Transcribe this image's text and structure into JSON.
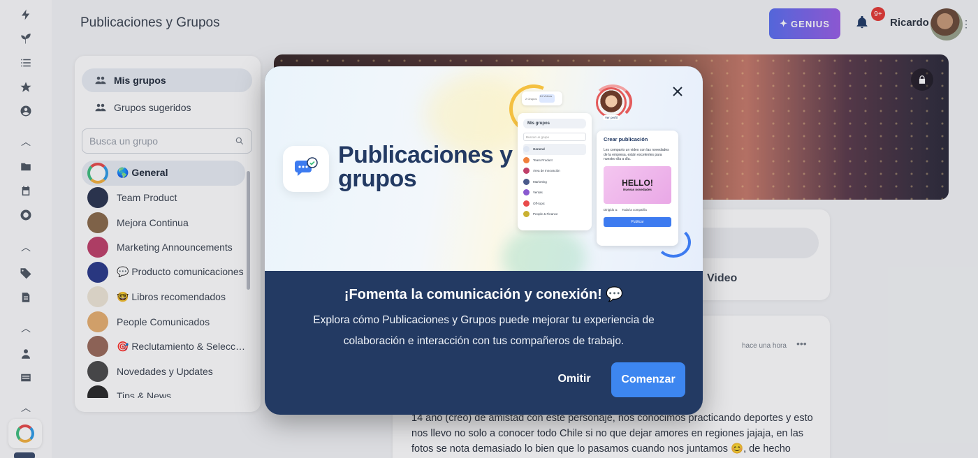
{
  "header": {
    "title": "Publicaciones y Grupos",
    "genius_label": "GENIUS",
    "notification_count": "9+",
    "user_name": "Ricardo"
  },
  "groups_panel": {
    "tabs": [
      {
        "label": "Mis grupos",
        "icon": "groups-icon",
        "active": true
      },
      {
        "label": "Grupos sugeridos",
        "icon": "groups-outline-icon",
        "active": false
      }
    ],
    "search_placeholder": "Busca un grupo",
    "groups": [
      {
        "label": "🌎 General",
        "color": "#e9edf4",
        "active": true
      },
      {
        "label": "Team Product",
        "color": "#2b3550"
      },
      {
        "label": "Mejora Continua",
        "color": "#8a6a4a"
      },
      {
        "label": "Marketing Announcements",
        "color": "#c0406a"
      },
      {
        "label": "💬 Producto comunicaciones",
        "color": "#2a3a8a"
      },
      {
        "label": "🤓 Libros recomendados",
        "color": "#f0e7d8"
      },
      {
        "label": "People Comunicados",
        "color": "#e8b070"
      },
      {
        "label": "🎯 Reclutamiento & Selección",
        "color": "#9a6a5a"
      },
      {
        "label": "Novedades y Updates",
        "color": "#4a4a4a"
      },
      {
        "label": "Tips & News",
        "color": "#2a2a2a"
      }
    ]
  },
  "composer": {
    "video_label": "Video"
  },
  "post": {
    "time": "hace una hora",
    "text": "14 año (creo) de amistad con este personaje, nos conocimos practicando deportes y esto nos llevo no solo a conocer todo Chile si no que dejar amores en regiones jajaja, en las fotos se nota demasiado lo bien que lo pasamos cuando nos juntamos 😊, de hecho"
  },
  "modal": {
    "hero_title": "Publicaciones y grupos",
    "heading": "¡Fomenta la comunicación y conexión! 💬",
    "body": "Explora cómo Publicaciones y Grupos puede mejorar tu experiencia de colaboración e interacción con tus compañeros de trabajo.",
    "skip_label": "Omitir",
    "start_label": "Comenzar",
    "mock": {
      "chip_a": "2 Grupos",
      "chip_b": "14 Videos",
      "groups_title": "Mis grupos",
      "groups_search": "Buscar un grupo",
      "groups": [
        "General",
        "Team Product",
        "Área de Innovación",
        "Marketing",
        "Ventas",
        "Off-topic",
        "People & Finance"
      ],
      "profile_label": "Ver perfil",
      "post_title": "Crear publicación",
      "post_text": "Les comparto un video con las novedades de la empresa, están excelentes para nuestro día a día.",
      "hello": "HELLO!",
      "hello_sub": "Nuevas novedades",
      "directed_label": "Dirigido a:",
      "directed_value": "Toda la compañía",
      "publish_label": "Publicar"
    }
  },
  "colors": {
    "modal_bg": "#233a63",
    "primary": "#3d86f0",
    "badge": "#e53935"
  }
}
